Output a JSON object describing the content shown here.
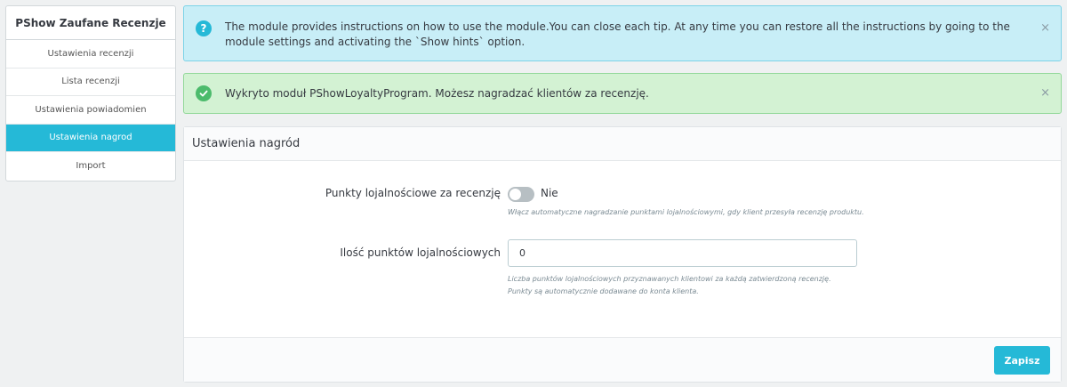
{
  "sidebar": {
    "title": "PShow Zaufane Recenzje",
    "items": [
      {
        "label": "Ustawienia recenzji"
      },
      {
        "label": "Lista recenzji"
      },
      {
        "label": "Ustawienia powiadomien"
      },
      {
        "label": "Ustawienia nagrod",
        "active": true
      },
      {
        "label": "Import"
      }
    ]
  },
  "alerts": {
    "info": {
      "icon": "question-icon",
      "text": "The module provides instructions on how to use the module.You can close each tip. At any time you can restore all the instructions by going to the module settings and activating the `Show hints` option.",
      "close": "×"
    },
    "success": {
      "icon": "check-icon",
      "text": "Wykryto moduł PShowLoyaltyProgram. Możesz nagradzać klientów za recenzję.",
      "close": "×"
    }
  },
  "panel": {
    "heading": "Ustawienia nagród",
    "fields": {
      "loyalty_toggle": {
        "label": "Punkty lojalnościowe za recenzję",
        "state_text": "Nie",
        "help": "Włącz automatyczne nagradzanie punktami lojalnościowymi, gdy klient przesyła recenzję produktu."
      },
      "points_amount": {
        "label": "Ilość punktów lojalnościowych",
        "value": "0",
        "help_line1": "Liczba punktów lojalnościowych przyznawanych klientowi za każdą zatwierdzoną recenzję.",
        "help_line2": "Punkty są automatycznie dodawane do konta klienta."
      }
    },
    "save_label": "Zapisz"
  },
  "colors": {
    "accent": "#25b9d7",
    "info_bg": "#c8eef7",
    "success_bg": "#d3f2d3"
  }
}
